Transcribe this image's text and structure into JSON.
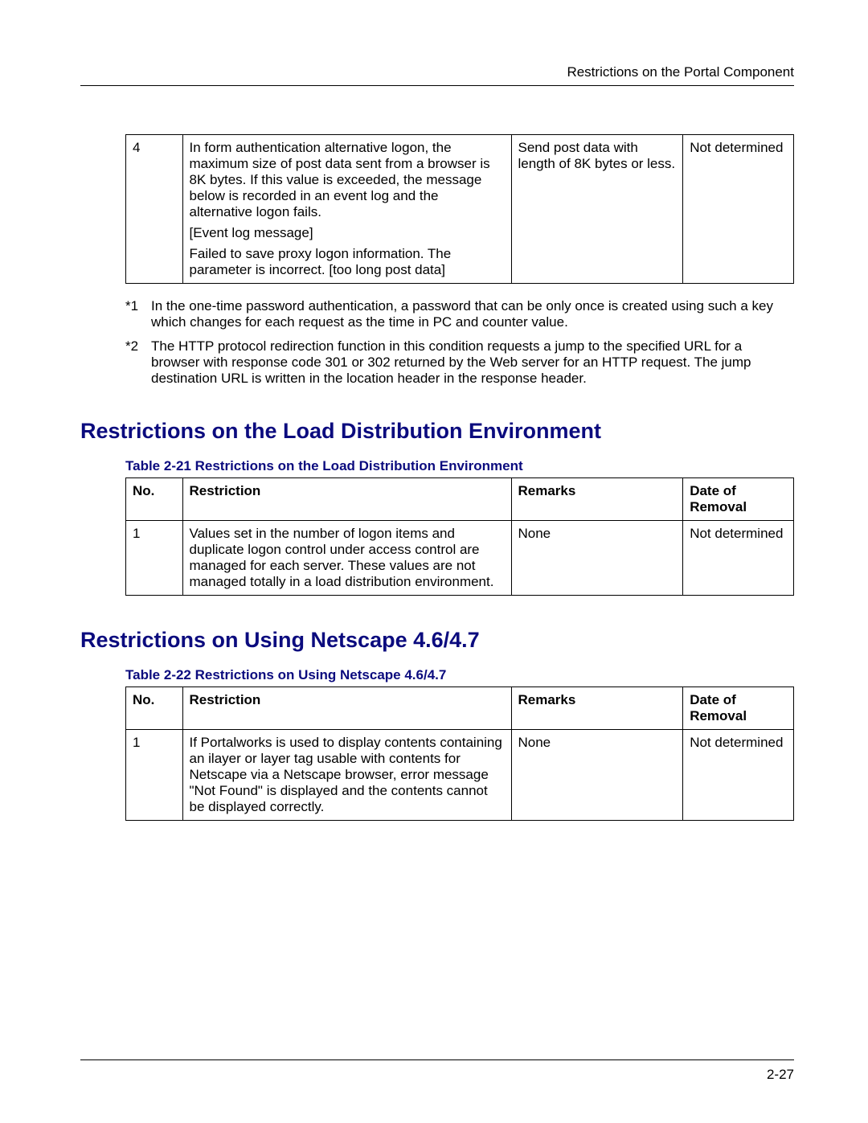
{
  "header": {
    "running": "Restrictions on the Portal Component"
  },
  "topTable": {
    "row": {
      "no": "4",
      "restriction_p1": "In form authentication alternative logon, the maximum size of post data sent from a browser is 8K bytes.  If this value is exceeded, the message below is recorded in an event log and the alternative logon fails.",
      "restriction_p2": "[Event log message]",
      "restriction_p3": "Failed to save proxy logon information. The parameter is incorrect.  [too long post data]",
      "remarks": "Send post data with length of 8K bytes or less.",
      "date": "Not determined"
    }
  },
  "footnotes": [
    {
      "mark": "*1",
      "text": "In the one-time password authentication, a password that can be only once is created using such a key which changes for each request as the time in PC and counter value."
    },
    {
      "mark": "*2",
      "text": "The HTTP protocol redirection function in this condition requests a jump to the specified URL for a browser with response code 301 or 302 returned by the Web server for an HTTP request.  The jump destination URL is written in the location header in the response header."
    }
  ],
  "section1": {
    "heading": "Restrictions on the Load Distribution Environment",
    "caption": "Table 2-21  Restrictions on the Load Distribution Environment",
    "headers": {
      "no": "No.",
      "restriction": "Restriction",
      "remarks": "Remarks",
      "date": "Date of Removal"
    },
    "rows": [
      {
        "no": "1",
        "restriction": "Values set in the number of logon items and duplicate logon control under access control are managed for each server.  These values are not managed totally in a load distribution environment.",
        "remarks": "None",
        "date": "Not determined"
      }
    ]
  },
  "section2": {
    "heading": "Restrictions on Using Netscape 4.6/4.7",
    "caption": "Table 2-22 Restrictions on Using Netscape 4.6/4.7",
    "headers": {
      "no": "No.",
      "restriction": "Restriction",
      "remarks": "Remarks",
      "date": "Date of Removal"
    },
    "rows": [
      {
        "no": "1",
        "restriction": "If Portalworks is used to display contents containing an ilayer or layer tag usable with contents for Netscape via a Netscape browser, error message \"Not Found\" is displayed and the contents cannot be displayed correctly.",
        "remarks": "None",
        "date": "Not determined"
      }
    ]
  },
  "footer": {
    "pageNumber": "2-27"
  }
}
